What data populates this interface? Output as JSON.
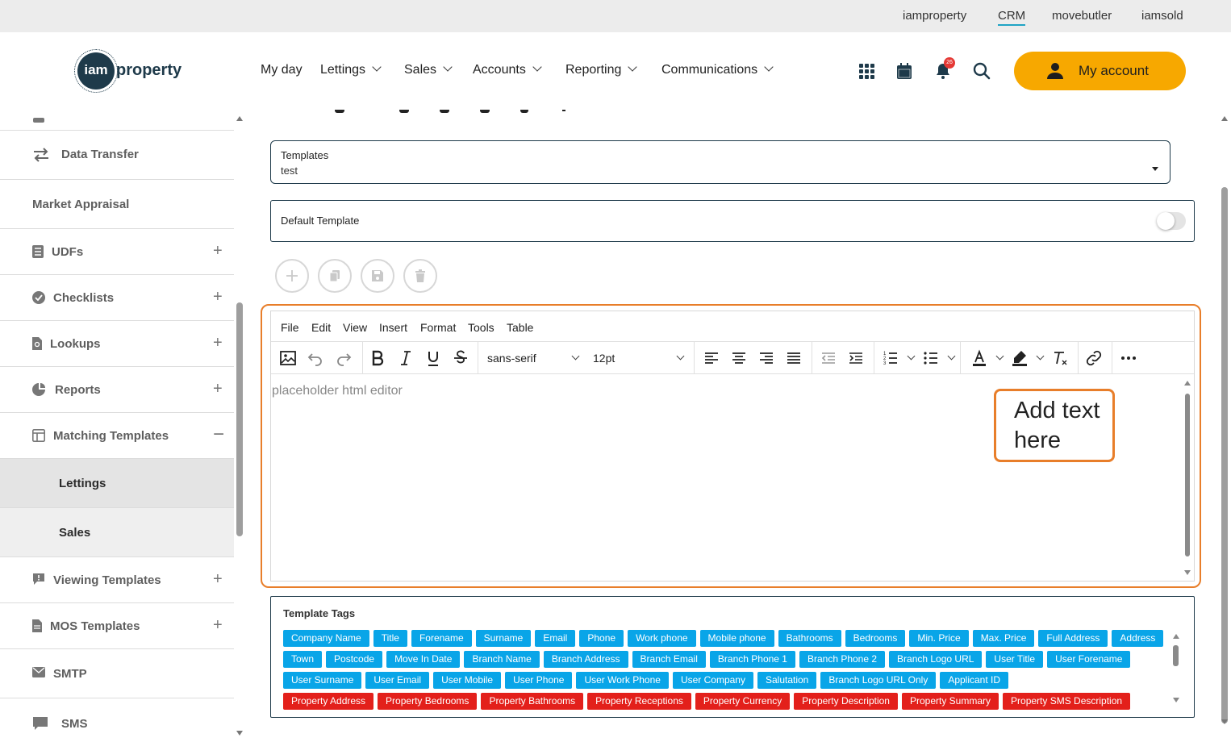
{
  "top_links": [
    "iamproperty",
    "CRM",
    "movebutler",
    "iamsold"
  ],
  "logo": {
    "circle_text": "iam",
    "word": "property"
  },
  "nav": {
    "my_day": "My day",
    "lettings": "Lettings",
    "sales": "Sales",
    "accounts": "Accounts",
    "reporting": "Reporting",
    "communications": "Communications"
  },
  "notifications_count": "26",
  "account_button": "My account",
  "sidebar": {
    "data_transfer": "Data Transfer",
    "market_appraisal": "Market Appraisal",
    "udfs": "UDFs",
    "checklists": "Checklists",
    "lookups": "Lookups",
    "reports": "Reports",
    "matching_templates": "Matching Templates",
    "lettings": "Lettings",
    "sales": "Sales",
    "viewing_templates": "Viewing Templates",
    "mos_templates": "MOS Templates",
    "smtp": "SMTP",
    "sms": "SMS"
  },
  "templates": {
    "label": "Templates",
    "value": "test"
  },
  "default_template": {
    "label": "Default Template",
    "enabled": false
  },
  "editor": {
    "menus": [
      "File",
      "Edit",
      "View",
      "Insert",
      "Format",
      "Tools",
      "Table"
    ],
    "font_family": "sans-serif",
    "font_size": "12pt",
    "placeholder": "placeholder html editor"
  },
  "callout": "Add text here",
  "tags": {
    "title": "Template Tags",
    "rows": [
      [
        "Company Name",
        "Title",
        "Forename",
        "Surname",
        "Email",
        "Phone",
        "Work phone",
        "Mobile phone",
        "Bathrooms",
        "Bedrooms",
        "Min. Price",
        "Max. Price",
        "Full Address",
        "Address"
      ],
      [
        "Town",
        "Postcode",
        "Move In Date",
        "Branch Name",
        "Branch Address",
        "Branch Email",
        "Branch Phone 1",
        "Branch Phone 2",
        "Branch Logo URL",
        "User Title",
        "User Forename"
      ],
      [
        "User Surname",
        "User Email",
        "User Mobile",
        "User Phone",
        "User Work Phone",
        "User Company",
        "Salutation",
        "Branch Logo URL Only",
        "Applicant ID"
      ],
      [
        "Property Address",
        "Property Bedrooms",
        "Property Bathrooms",
        "Property Receptions",
        "Property Currency",
        "Property Description",
        "Property Summary",
        "Property SMS Description"
      ]
    ],
    "colors": {
      "contact": "#09a5e8",
      "property": "#e3201b"
    }
  },
  "colors": {
    "accent": "#f7a800",
    "brand": "#1e3a4a",
    "highlight": "#e87e2a"
  }
}
